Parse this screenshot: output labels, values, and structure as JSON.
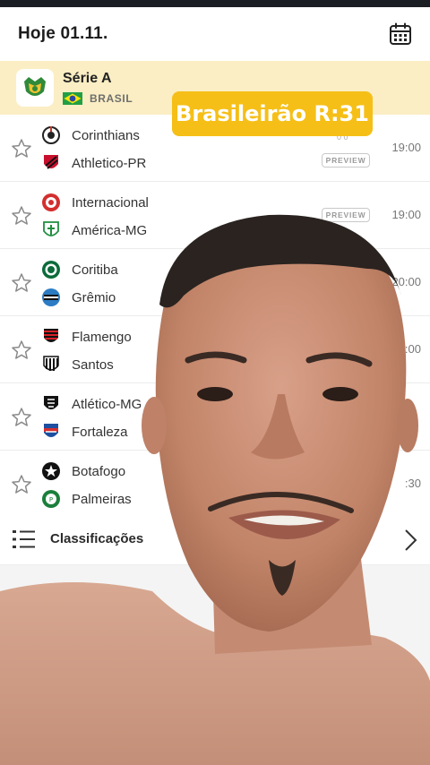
{
  "header": {
    "date_label": "Hoje 01.11.",
    "calendar_icon": "calendar-icon"
  },
  "league": {
    "name": "Série A",
    "country": "BRASIL"
  },
  "overlay": {
    "caption": "Brasileirão R:31",
    "color": "#f5bf17"
  },
  "matches": [
    {
      "home": "Corinthians",
      "away": "Athletico-PR",
      "time": "19:00",
      "badge": "PREVIEW",
      "odds": "0 0"
    },
    {
      "home": "Internacional",
      "away": "América-MG",
      "time": "19:00",
      "badge": "PREVIEW"
    },
    {
      "home": "Coritiba",
      "away": "Grêmio",
      "time": "20:00"
    },
    {
      "home": "Flamengo",
      "away": "Santos",
      "time": ":00"
    },
    {
      "home": "Atlético-MG",
      "away": "Fortaleza",
      "time": ""
    },
    {
      "home": "Botafogo",
      "away": "Palmeiras",
      "time": ":30"
    }
  ],
  "standings": {
    "label": "Classificações"
  },
  "colors": {
    "league_bg": "#fbeec4",
    "badge_bg": "#f5bf17",
    "topbar": "#1b1f24"
  }
}
